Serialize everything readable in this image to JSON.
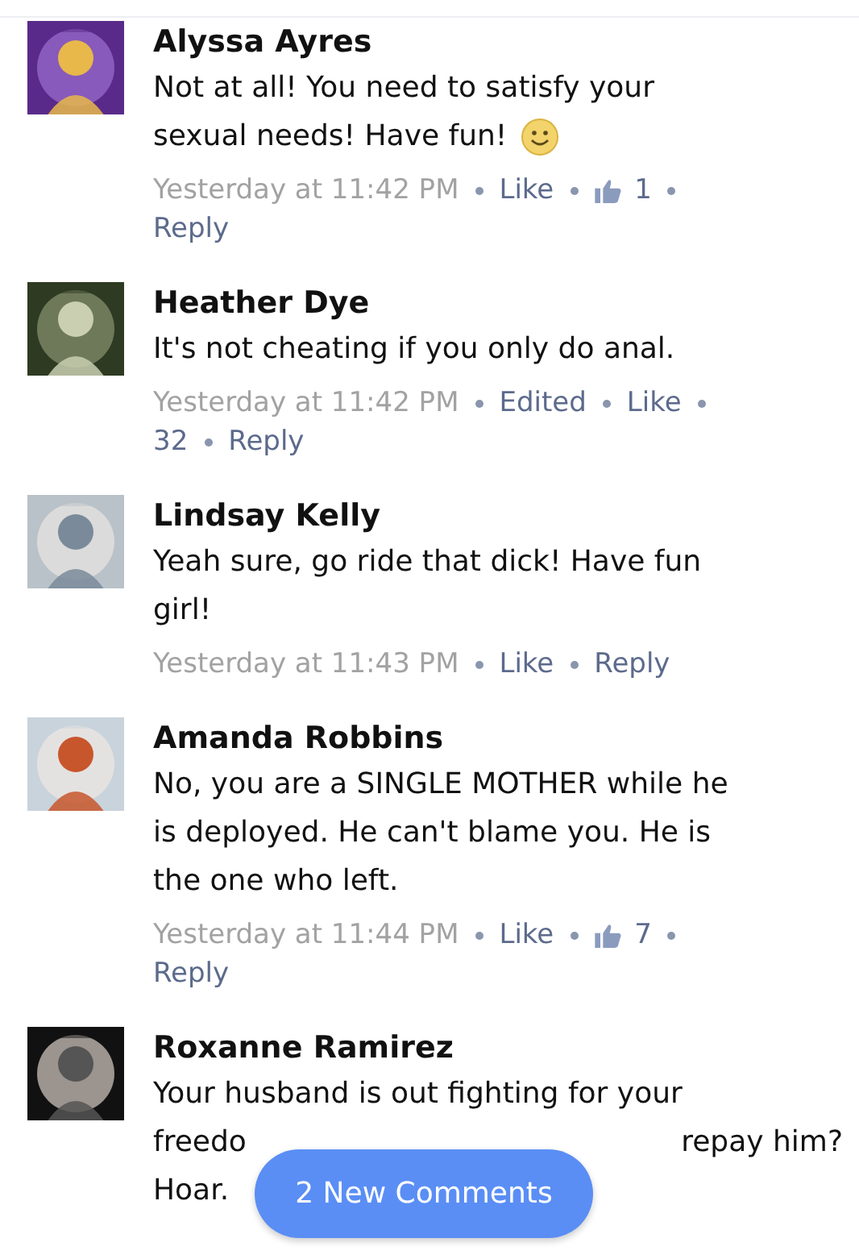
{
  "comments": [
    {
      "author": "Alyssa Ayres",
      "lines": [
        [
          "Not at all! You need to satisfy your"
        ],
        [
          "sexual needs! Have fun!"
        ]
      ],
      "emoji": true,
      "meta": [
        {
          "kind": "time",
          "text": "Yesterday at 11:42 PM"
        },
        {
          "kind": "link",
          "text": "Like"
        },
        {
          "kind": "likes",
          "text": "1"
        },
        {
          "kind": "link",
          "text": "Reply"
        }
      ]
    },
    {
      "author": "Heather Dye",
      "lines": [
        [
          "It's not cheating if you only do anal."
        ]
      ],
      "emoji": false,
      "meta": [
        {
          "kind": "time",
          "text": "Yesterday at 11:42 PM"
        },
        {
          "kind": "link",
          "text": "Edited"
        },
        {
          "kind": "link",
          "text": "Like"
        },
        {
          "kind": "count",
          "text": "32"
        },
        {
          "kind": "link",
          "text": "Reply"
        }
      ]
    },
    {
      "author": "Lindsay Kelly",
      "lines": [
        [
          "Yeah sure, go ride that dick! Have fun"
        ],
        [
          "girl!"
        ]
      ],
      "emoji": false,
      "meta": [
        {
          "kind": "time",
          "text": "Yesterday at 11:43 PM"
        },
        {
          "kind": "link",
          "text": "Like"
        },
        {
          "kind": "link",
          "text": "Reply"
        }
      ]
    },
    {
      "author": "Amanda Robbins",
      "lines": [
        [
          "No, you are a SINGLE MOTHER while he"
        ],
        [
          "is deployed. He can't blame you. He is"
        ],
        [
          "the one who left."
        ]
      ],
      "emoji": false,
      "meta": [
        {
          "kind": "time",
          "text": "Yesterday at 11:44 PM"
        },
        {
          "kind": "link",
          "text": "Like"
        },
        {
          "kind": "likes",
          "text": "7"
        },
        {
          "kind": "link",
          "text": "Reply"
        }
      ]
    },
    {
      "author": "Roxanne Ramirez",
      "lines": [
        [
          "Your husband is out fighting for your"
        ],
        [
          "freedo",
          "repay him?"
        ],
        [
          "Hoar."
        ]
      ],
      "emoji": false
    }
  ],
  "new_comments_button": {
    "label": "2 New Comments"
  }
}
